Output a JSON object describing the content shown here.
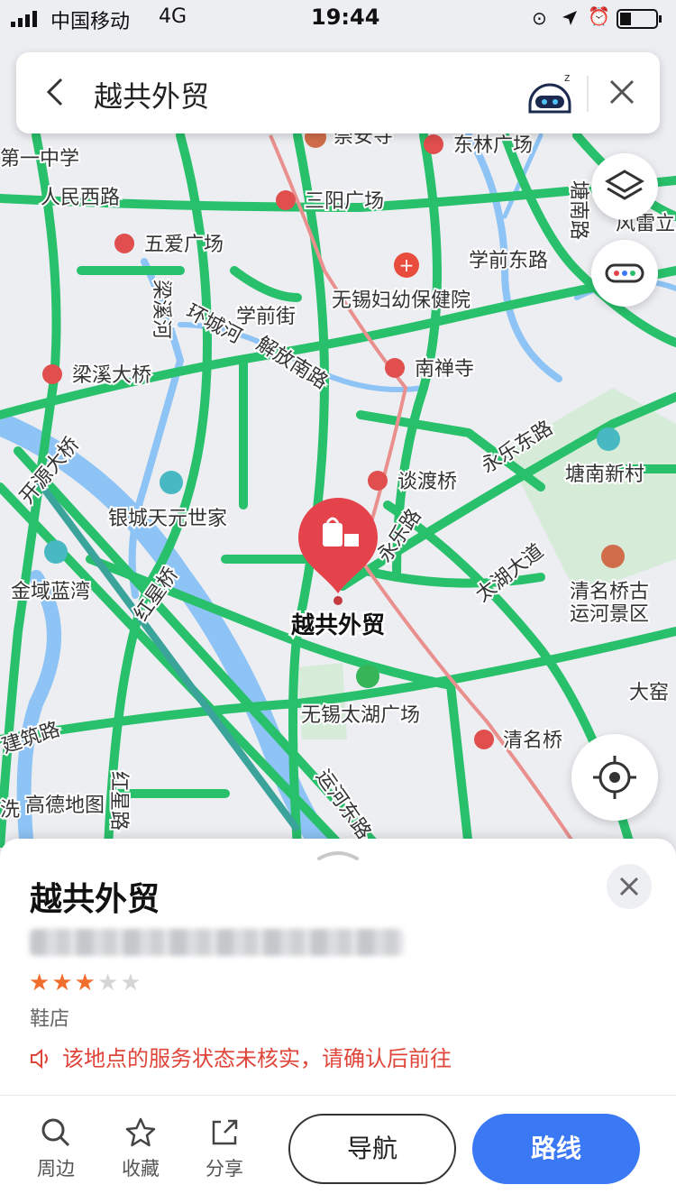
{
  "status_bar": {
    "carrier": "中国移动",
    "network": "4G",
    "time": "19:44"
  },
  "search": {
    "query": "越共外贸"
  },
  "map": {
    "selected_poi": "越共外贸",
    "labels": {
      "no1_middle_school": "第一中学",
      "renmin_west_road": "人民西路",
      "chongan_temple": "崇安寺",
      "donglin_square": "东林广场",
      "tangnan_road": "塘南路",
      "fengleili": "风雷立",
      "sanyang_square": "三阳广场",
      "wuai_square": "五爱广场",
      "xueqian_east_road": "学前东路",
      "maternal_hospital": "无锡妇幼保健院",
      "liangxi_river": "梁溪河",
      "huancheng_river": "环城河",
      "xueqian_street": "学前街",
      "jiefang_south_road": "解放南路",
      "liangxi_bridge": "梁溪大桥",
      "nanchan_temple": "南禅寺",
      "kaiyuan_bridge": "开源大桥",
      "yongle_east_road": "永乐东路",
      "tangnan_xincun": "塘南新村",
      "tandu_bridge": "谈渡桥",
      "yincheng_tianyuan": "银城天元世家",
      "yongle_road": "永乐路",
      "jinyu_lanwan": "金域蓝湾",
      "hongxing_bridge": "红星桥",
      "taihu_avenue": "太湖大道",
      "qingming_canal_line1": "清名桥古",
      "qingming_canal_line2": "运河景区",
      "dadou": "大窑",
      "taihu_square": "无锡太湖广场",
      "jianzhu_road": "建筑路",
      "qingming_bridge": "清名桥",
      "gaode_map": "高德地图",
      "hongxing_road": "红星路",
      "yunhe_east_road": "运河东路",
      "xi_jiao": "洗"
    }
  },
  "sheet": {
    "place_name": "越共外贸",
    "rating": 3,
    "rating_max": 5,
    "category": "鞋店",
    "warning": "该地点的服务状态未核实，请确认后前往"
  },
  "actions": {
    "nearby": "周边",
    "favorite": "收藏",
    "share": "分享",
    "navigate": "导航",
    "route": "路线"
  },
  "colors": {
    "road_traffic": "#29c06b",
    "water": "#8ec3f5",
    "metro_red": "#e04e4e",
    "route_button": "#3b79f4",
    "warning_red": "#e0453a",
    "star_on": "#f06d2e",
    "poi_marker": "#e5434b"
  }
}
